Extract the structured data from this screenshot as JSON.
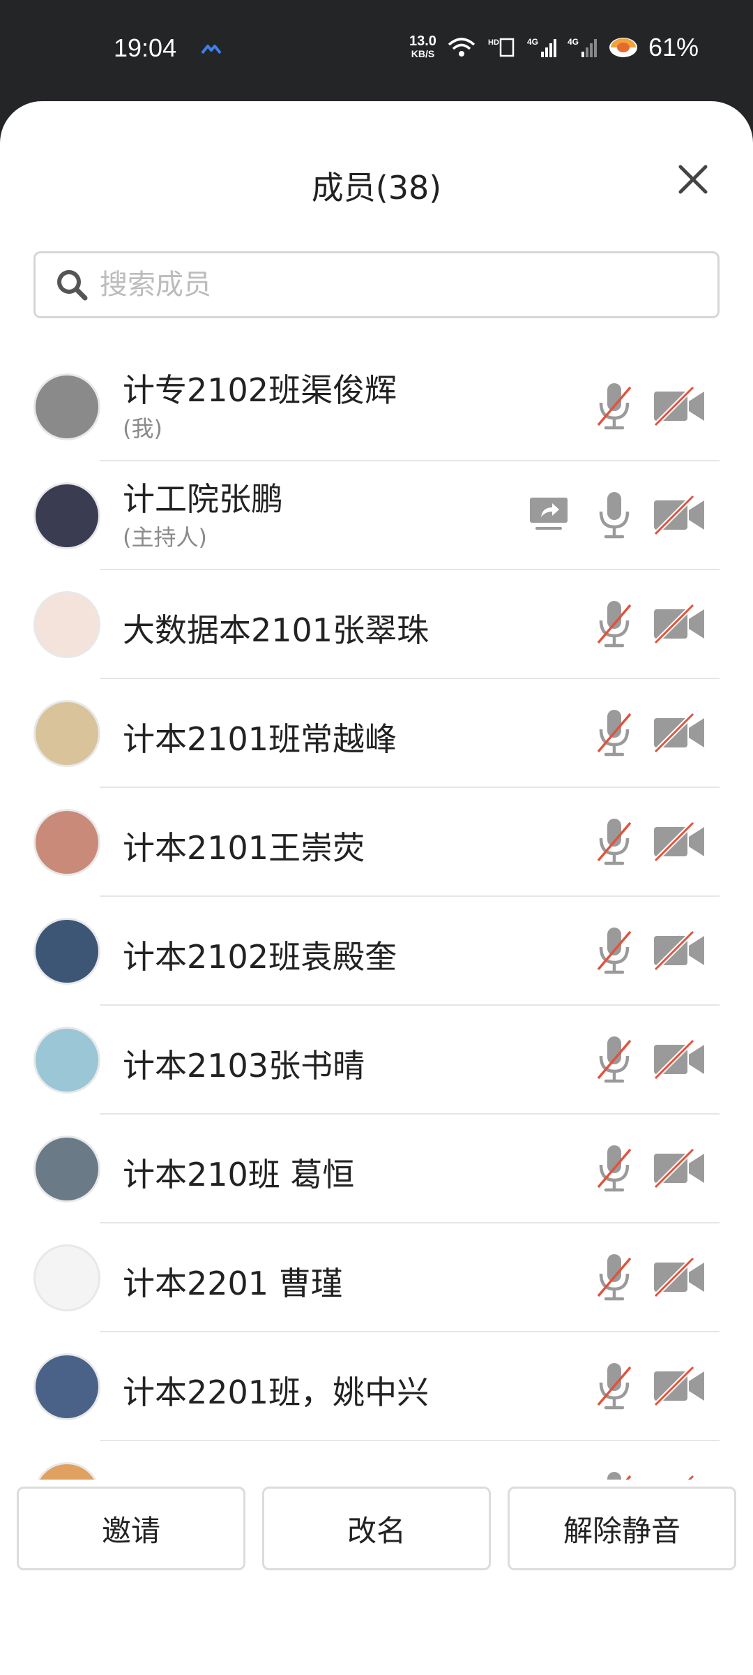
{
  "status_bar": {
    "time": "19:04",
    "speed_value": "13.0",
    "speed_unit": "KB/S",
    "battery": "61%",
    "icons": [
      "app-notification-icon",
      "wifi-icon",
      "hd-icon",
      "signal-4g-icon",
      "signal-4g-icon",
      "battery-icon"
    ]
  },
  "sheet": {
    "title": "成员(38)",
    "close_icon": "close-icon"
  },
  "search": {
    "placeholder": "搜索成员",
    "value": ""
  },
  "members": [
    {
      "name": "计专2102班渠俊辉",
      "sub": "(我)",
      "avatar_color": "#8a8a8a",
      "mic": "muted",
      "cam": "off"
    },
    {
      "name": "计工院张鹏",
      "sub": "(主持人)",
      "avatar_color": "#3a3d52",
      "share": true,
      "mic": "on",
      "cam": "off"
    },
    {
      "name": "大数据本2101张翠珠",
      "sub": "",
      "avatar_color": "#f3e3da",
      "mic": "muted",
      "cam": "off"
    },
    {
      "name": "计本2101班常越峰",
      "sub": "",
      "avatar_color": "#d9c39a",
      "mic": "muted",
      "cam": "off"
    },
    {
      "name": "计本2101王崇荧",
      "sub": "",
      "avatar_color": "#c98a7a",
      "mic": "muted",
      "cam": "off"
    },
    {
      "name": "计本2102班袁殿奎",
      "sub": "",
      "avatar_color": "#3d5676",
      "mic": "muted",
      "cam": "off"
    },
    {
      "name": "计本2103张书晴",
      "sub": "",
      "avatar_color": "#9ac6d6",
      "mic": "muted",
      "cam": "off"
    },
    {
      "name": "计本210班  葛恒",
      "sub": "",
      "avatar_color": "#6a7a86",
      "mic": "muted",
      "cam": "off"
    },
    {
      "name": "计本2201 曹瑾",
      "sub": "",
      "avatar_color": "#f4f4f4",
      "mic": "muted",
      "cam": "off"
    },
    {
      "name": "计本2201班，姚中兴",
      "sub": "",
      "avatar_color": "#4a6288",
      "mic": "muted",
      "cam": "off"
    },
    {
      "name": "",
      "sub": "",
      "avatar_color": "#e0a060",
      "mic": "muted",
      "cam": "off"
    }
  ],
  "buttons": {
    "invite": "邀请",
    "rename": "改名",
    "unmute": "解除静音"
  },
  "colors": {
    "muted_red": "#e0533d",
    "icon_gray": "#9a9a9a"
  }
}
